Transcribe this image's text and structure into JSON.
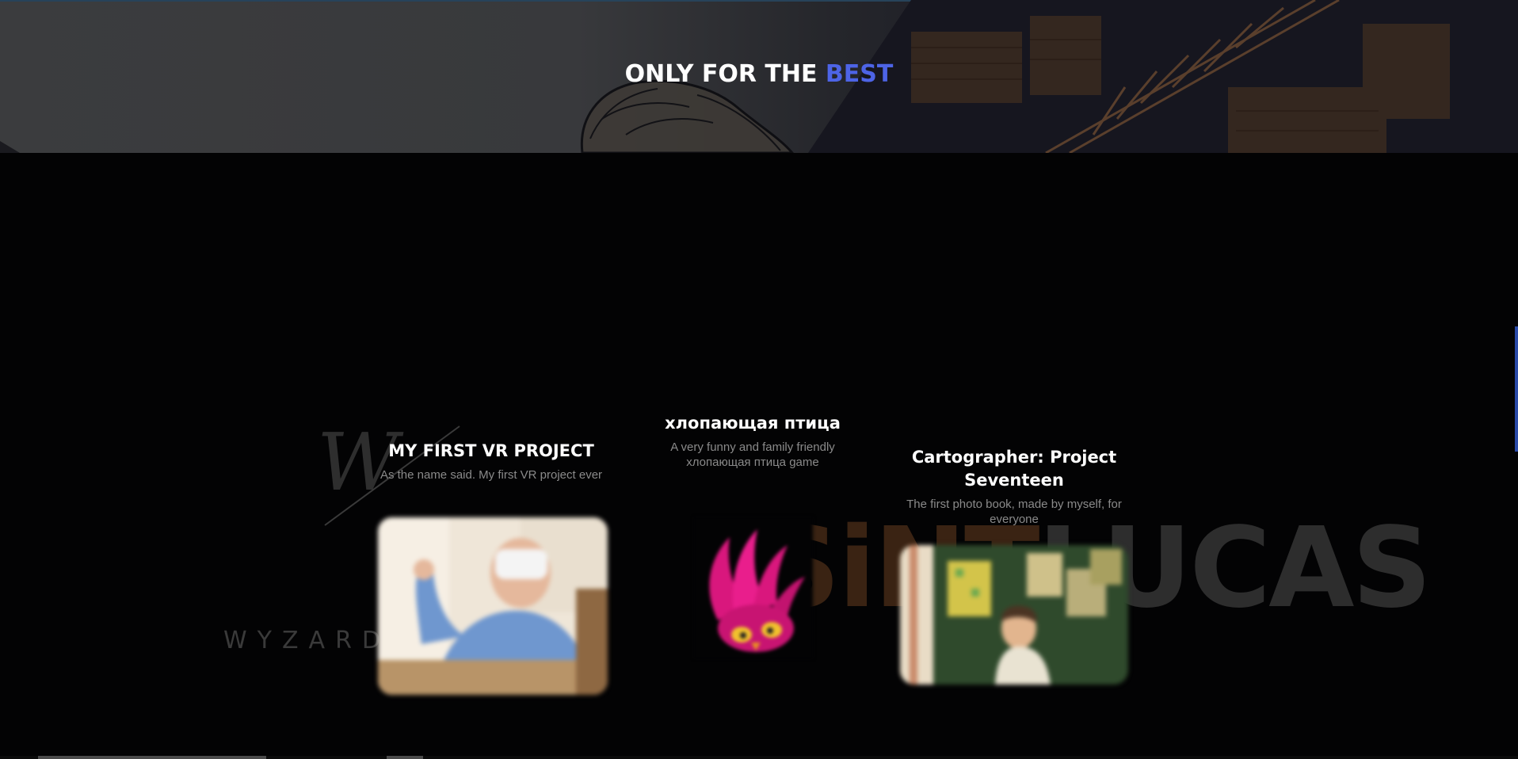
{
  "hero": {
    "title_main": "ONLY FOR THE ",
    "title_accent": "BEST",
    "accent_color": "#4d64e6"
  },
  "logos": {
    "wyzard_text": "WYZARD",
    "sintlucas_text_a": "SiNT",
    "sintlucas_text_b": "LUCAS"
  },
  "projects": [
    {
      "title": "MY FIRST VR PROJECT",
      "description": "As the name said. My first VR project ever",
      "image": "vr-headset-photo"
    },
    {
      "title": "хлопающая птица",
      "description": "A very funny and family friendly хлопающая птица game",
      "image": "pink-bird-icon"
    },
    {
      "title": "Cartographer: Project Seventeen",
      "description": "The first photo book, made by myself, for everyone",
      "image": "photo-book-cover"
    }
  ],
  "colors": {
    "background": "#030304",
    "text": "#ffffff",
    "muted": "#8a8a8a"
  }
}
